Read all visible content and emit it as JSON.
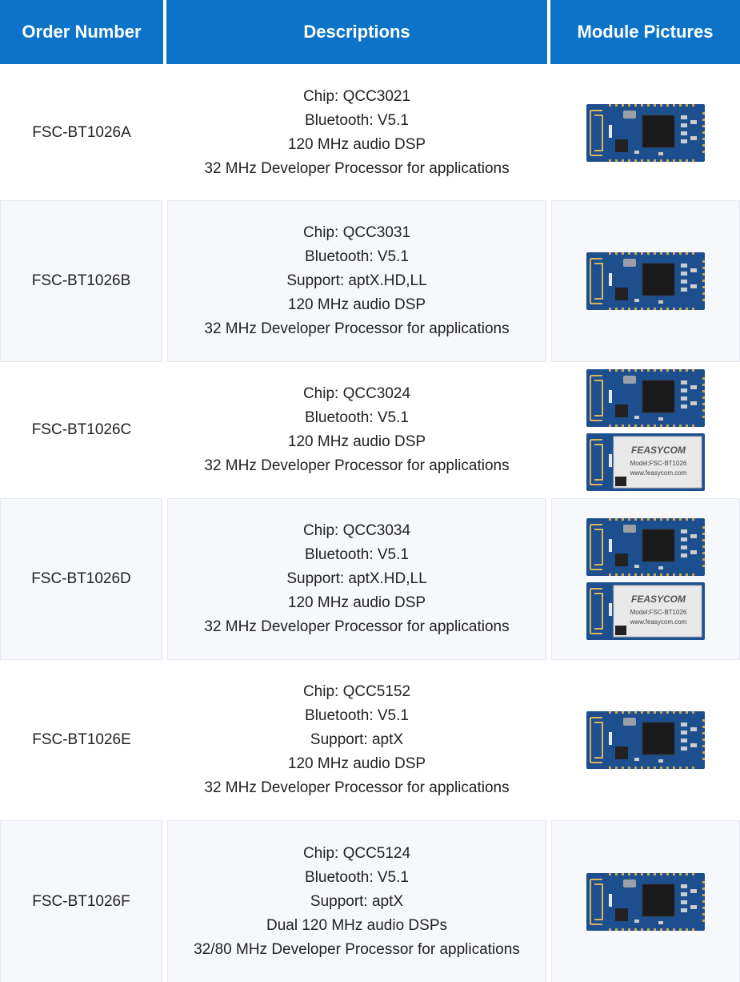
{
  "header": {
    "order_number": "Order Number",
    "descriptions": "Descriptions",
    "module_pictures": "Module Pictures"
  },
  "rows": [
    {
      "order": "FSC-BT1026A",
      "desc": [
        "Chip: QCC3021",
        "Bluetooth: V5.1",
        "120 MHz audio DSP",
        "32 MHz Developer Processor for applications"
      ],
      "pictures": [
        "bare-module"
      ]
    },
    {
      "order": "FSC-BT1026B",
      "desc": [
        "Chip: QCC3031",
        "Bluetooth: V5.1",
        "Support: aptX.HD,LL",
        "120 MHz audio DSP",
        "32 MHz Developer Processor for applications"
      ],
      "pictures": [
        "bare-module"
      ]
    },
    {
      "order": "FSC-BT1026C",
      "desc": [
        "Chip: QCC3024",
        "Bluetooth: V5.1",
        "120 MHz audio DSP",
        "32 MHz Developer Processor for applications"
      ],
      "pictures": [
        "bare-module",
        "shielded-module"
      ]
    },
    {
      "order": "FSC-BT1026D",
      "desc": [
        "Chip: QCC3034",
        "Bluetooth: V5.1",
        "Support: aptX.HD,LL",
        "120 MHz audio DSP",
        "32 MHz Developer Processor for applications"
      ],
      "pictures": [
        "bare-module",
        "shielded-module"
      ]
    },
    {
      "order": "FSC-BT1026E",
      "desc": [
        "Chip: QCC5152",
        "Bluetooth: V5.1",
        "Support: aptX",
        "120 MHz audio DSP",
        "32 MHz Developer Processor for applications"
      ],
      "pictures": [
        "bare-module"
      ]
    },
    {
      "order": "FSC-BT1026F",
      "desc": [
        "Chip: QCC5124",
        "Bluetooth: V5.1",
        "Support: aptX",
        "Dual 120 MHz audio DSPs",
        "32/80 MHz Developer Processor for applications"
      ],
      "pictures": [
        "bare-module"
      ]
    }
  ],
  "module_label": {
    "brand": "FEASYCOM",
    "model": "Model:FSC-BT1026",
    "site": "www.feasycom.com"
  },
  "colors": {
    "header_bg": "#0c74c8",
    "header_text": "#ffffff",
    "pcb_blue": "#1d4f8f",
    "alt_row_bg": "#f6f8fb"
  }
}
